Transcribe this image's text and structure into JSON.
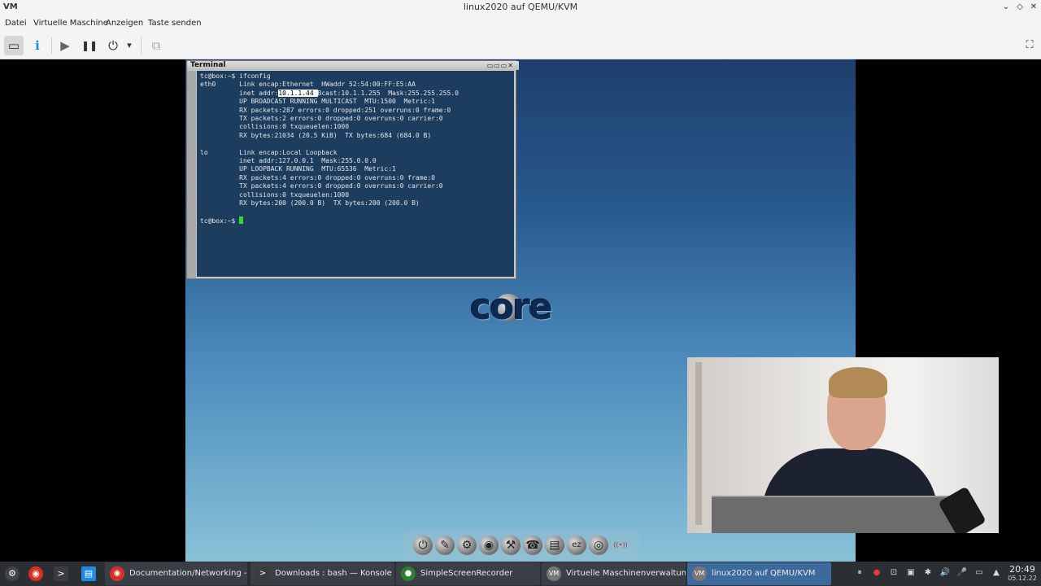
{
  "window": {
    "title": "linux2020 auf QEMU/KVM",
    "logo_text": "VM",
    "controls": [
      "⌄",
      "◇",
      "✕"
    ]
  },
  "menu": {
    "items": [
      "Datei",
      "Virtuelle Maschine",
      "Anzeigen",
      "Taste senden"
    ]
  },
  "toolbar": {
    "icons": [
      "screen-icon",
      "info-icon",
      "play-icon",
      "pause-icon",
      "power-icon",
      "dropdown-icon",
      "snapshots-icon",
      "fullscreen-icon"
    ],
    "glyphs": {
      "screen": "▭",
      "info": "ℹ",
      "play": "▶",
      "pause": "❚❚",
      "power": "⏻",
      "dropdown": "▾",
      "snapshots": "⧉",
      "fullscreen": "⛶"
    }
  },
  "terminal": {
    "title": "Terminal",
    "buttons": "▭▭▭✕",
    "lines": [
      "tc@box:~$ ifconfig",
      "eth0      Link encap:Ethernet  HWaddr 52:54:00:FF:E5:AA",
      "          inet addr:",
      "          UP BROADCAST RUNNING MULTICAST  MTU:1500  Metric:1",
      "          RX packets:287 errors:0 dropped:251 overruns:0 frame:0",
      "          TX packets:2 errors:0 dropped:0 overruns:0 carrier:0",
      "          collisions:0 txqueuelen:1000",
      "          RX bytes:21034 (20.5 KiB)  TX bytes:684 (684.0 B)",
      "",
      "lo        Link encap:Local Loopback",
      "          inet addr:127.0.0.1  Mask:255.0.0.0",
      "          UP LOOPBACK RUNNING  MTU:65536  Metric:1",
      "          RX packets:4 errors:0 dropped:0 overruns:0 frame:0",
      "          TX packets:4 errors:0 dropped:0 overruns:0 carrier:0",
      "          collisions:0 txqueuelen:1000",
      "          RX bytes:200 (200.0 B)  TX bytes:200 (200.0 B)",
      "",
      "tc@box:~$ "
    ],
    "highlight": "10.1.1.44 ",
    "line3_rest": "Bcast:10.1.1.255  Mask:255.255.255.0"
  },
  "desktop": {
    "logo_text": "core",
    "dock": [
      "⏻",
      "✎",
      "⚙",
      "◉",
      "⚒",
      "☎",
      "▤",
      "ez",
      "◎",
      "((•))"
    ]
  },
  "taskbar": {
    "launchers": [
      "⚙",
      "◉",
      ">",
      "▤"
    ],
    "tasks": [
      {
        "label": "Documentation/Networking - ...",
        "icon": "◉"
      },
      {
        "label": "Downloads : bash — Konsole",
        "icon": ">"
      },
      {
        "label": "SimpleScreenRecorder",
        "icon": "●"
      },
      {
        "label": "Virtuelle Maschinenverwaltung",
        "icon": "VM"
      },
      {
        "label": "linux2020 auf QEMU/KVM",
        "icon": "VM"
      }
    ],
    "tray": [
      "⏸",
      "●",
      "⊡",
      "▣",
      "✱",
      "🔊",
      "🎤",
      "▭",
      "▲"
    ],
    "time": "20:49",
    "date": "05.12.22"
  }
}
